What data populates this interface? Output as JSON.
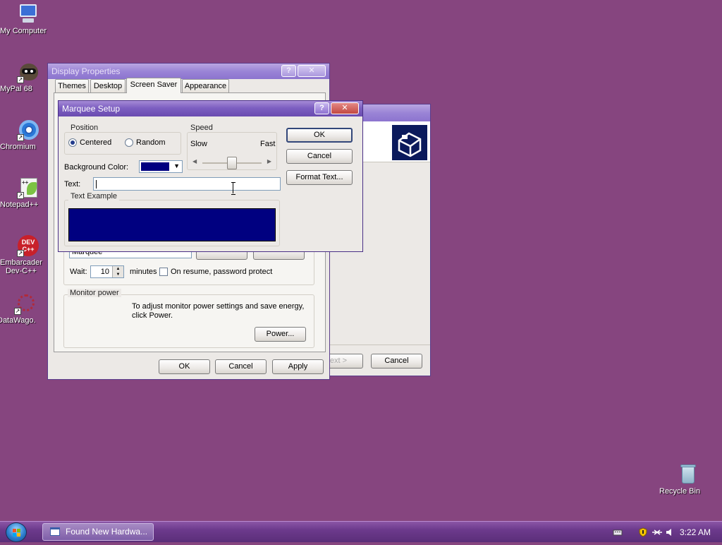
{
  "desktop": {
    "icons": [
      {
        "label": "My Computer"
      },
      {
        "label": "MyPal 68"
      },
      {
        "label": "Chromium"
      },
      {
        "label": "Notepad++"
      },
      {
        "label": "Embarcader\nDev-C++"
      },
      {
        "label": "DataWago."
      },
      {
        "label": "Recycle Bin"
      }
    ],
    "background_color": "#86457f"
  },
  "display_properties": {
    "title": "Display Properties",
    "help_glyph": "?",
    "close_glyph": "✕",
    "tabs": [
      {
        "label": "Themes"
      },
      {
        "label": "Desktop"
      },
      {
        "label": "Screen Saver"
      },
      {
        "label": "Appearance"
      }
    ],
    "active_tab": "Screen Saver",
    "screensaver_value": "Marquee",
    "wait_label": "Wait:",
    "wait_value": "10",
    "minutes_label": "minutes",
    "resume_label": "On resume, password protect",
    "monitor_power": {
      "label": "Monitor power",
      "text": "To adjust monitor power settings and save energy,\nclick Power.",
      "button": "Power..."
    },
    "buttons": {
      "ok": "OK",
      "cancel": "Cancel",
      "apply": "Apply"
    }
  },
  "wizard_window": {
    "next_label": "Next >",
    "cancel_label": "Cancel"
  },
  "marquee_setup": {
    "title": "Marquee Setup",
    "help_glyph": "?",
    "close_glyph": "✕",
    "position": {
      "label": "Position",
      "options": [
        {
          "label": "Centered",
          "checked": true
        },
        {
          "label": "Random",
          "checked": false
        }
      ]
    },
    "speed": {
      "label": "Speed",
      "slow_label": "Slow",
      "fast_label": "Fast",
      "value": 0.5
    },
    "background_color_label": "Background Color:",
    "background_color": "#000080",
    "text_label": "Text:",
    "text_value": "",
    "text_example_label": "Text Example",
    "buttons": {
      "ok": "OK",
      "cancel": "Cancel",
      "format_text": "Format Text..."
    }
  },
  "taskbar": {
    "task_label": "Found New Hardwa...",
    "clock": "3:22 AM"
  },
  "colors": {
    "title_active": "#7d5fc1",
    "marquee_preview": "#000080",
    "taskbar": "#6c3a8c"
  }
}
